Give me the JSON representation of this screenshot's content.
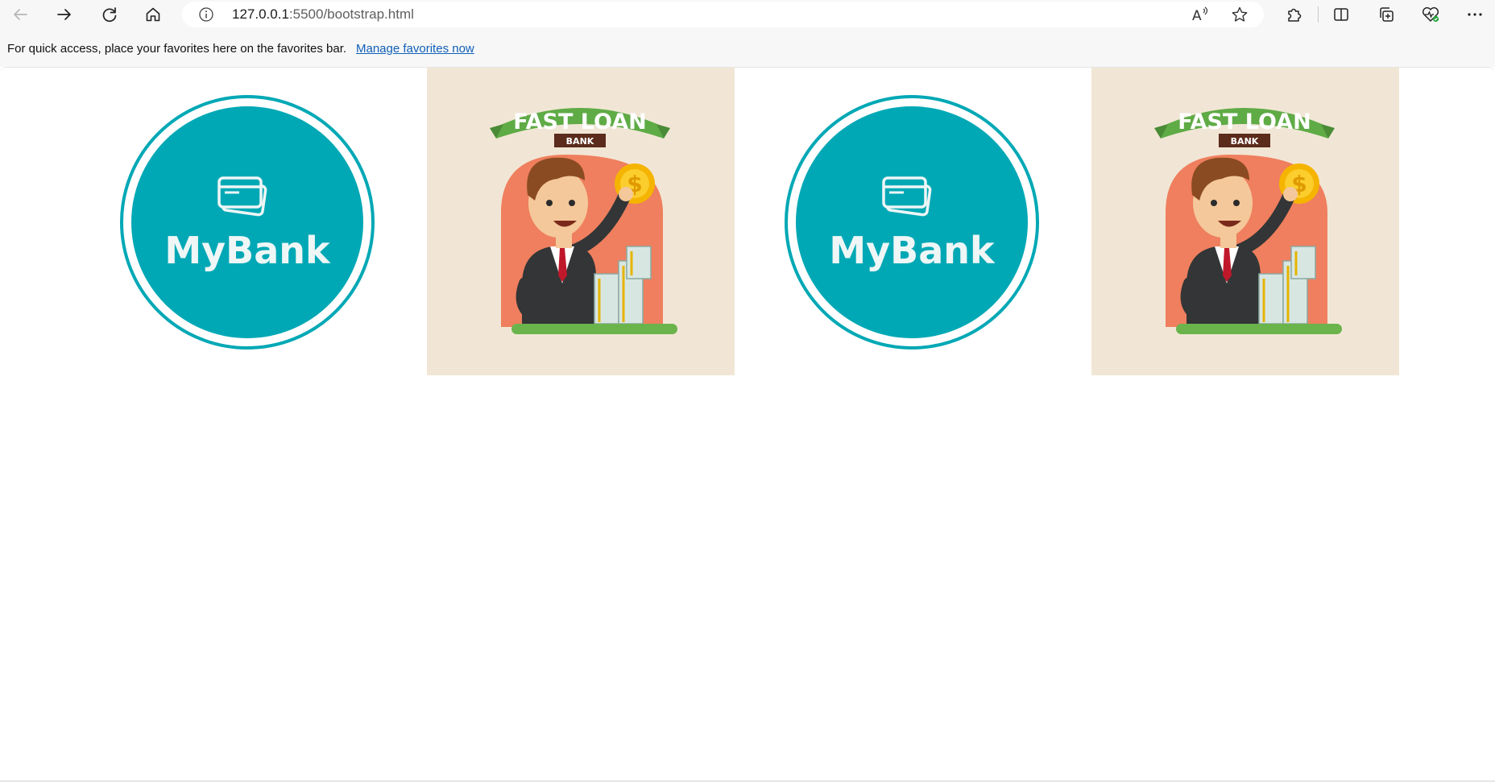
{
  "browser": {
    "url_host": "127.0.0.1",
    "url_path": ":5500/bootstrap.html",
    "toolbar_icons": [
      "back-icon",
      "forward-icon",
      "refresh-icon",
      "home-icon",
      "info-icon",
      "read-aloud-icon",
      "favorite-star-icon",
      "extensions-icon",
      "split-screen-icon",
      "collections-icon",
      "browser-essentials-icon",
      "more-icon"
    ]
  },
  "favorites_bar": {
    "message": "For quick access, place your favorites here on the favorites bar.",
    "link": "Manage favorites now"
  },
  "content": {
    "logos": [
      {
        "text": "MyBank",
        "icon": "credit-card-icon"
      },
      {
        "text": "MyBank",
        "icon": "credit-card-icon"
      }
    ],
    "loan_images": [
      {
        "title": "FAST LOAN",
        "subtitle": "BANK"
      },
      {
        "title": "FAST LOAN",
        "subtitle": "BANK"
      }
    ]
  },
  "colors": {
    "teal": "#00a8b5",
    "loan_bg": "#f1e6d5",
    "banner_green": "#5fab46",
    "arch_orange": "#ef7f5e",
    "coin_gold": "#f5b400",
    "link_blue": "#0f5fb8"
  }
}
